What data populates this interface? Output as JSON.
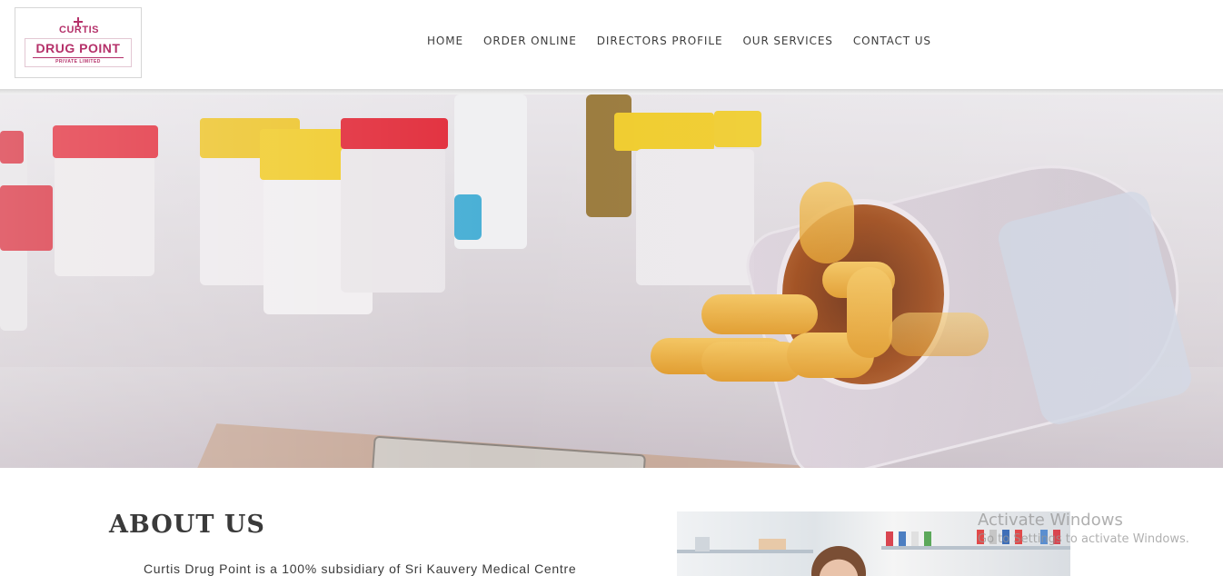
{
  "header": {
    "logo": {
      "top_text": "CURTIS",
      "main_text": "DRUG POINT",
      "sub_text": "PRIVATE LIMITED"
    },
    "nav": [
      {
        "label": "HOME"
      },
      {
        "label": "ORDER ONLINE"
      },
      {
        "label": "DIRECTORS PROFILE"
      },
      {
        "label": "OUR SERVICES"
      },
      {
        "label": "CONTACT US"
      }
    ]
  },
  "about": {
    "title": "ABOUT US",
    "text": "Curtis Drug Point is a 100% subsidiary of Sri Kauvery Medical Centre"
  },
  "watermark": {
    "title": "Activate Windows",
    "subtitle": "Go to Settings to activate Windows."
  },
  "colors": {
    "brand": "#b5316a",
    "nav_text": "#3d3d3d",
    "heading": "#3a3a3a"
  }
}
